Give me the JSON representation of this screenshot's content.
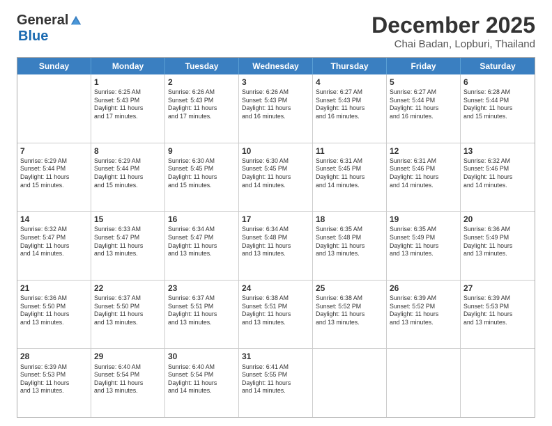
{
  "logo": {
    "general": "General",
    "blue": "Blue"
  },
  "title": "December 2025",
  "subtitle": "Chai Badan, Lopburi, Thailand",
  "header_days": [
    "Sunday",
    "Monday",
    "Tuesday",
    "Wednesday",
    "Thursday",
    "Friday",
    "Saturday"
  ],
  "weeks": [
    [
      {
        "day": "",
        "info": ""
      },
      {
        "day": "1",
        "info": "Sunrise: 6:25 AM\nSunset: 5:43 PM\nDaylight: 11 hours\nand 17 minutes."
      },
      {
        "day": "2",
        "info": "Sunrise: 6:26 AM\nSunset: 5:43 PM\nDaylight: 11 hours\nand 17 minutes."
      },
      {
        "day": "3",
        "info": "Sunrise: 6:26 AM\nSunset: 5:43 PM\nDaylight: 11 hours\nand 16 minutes."
      },
      {
        "day": "4",
        "info": "Sunrise: 6:27 AM\nSunset: 5:43 PM\nDaylight: 11 hours\nand 16 minutes."
      },
      {
        "day": "5",
        "info": "Sunrise: 6:27 AM\nSunset: 5:44 PM\nDaylight: 11 hours\nand 16 minutes."
      },
      {
        "day": "6",
        "info": "Sunrise: 6:28 AM\nSunset: 5:44 PM\nDaylight: 11 hours\nand 15 minutes."
      }
    ],
    [
      {
        "day": "7",
        "info": "Sunrise: 6:29 AM\nSunset: 5:44 PM\nDaylight: 11 hours\nand 15 minutes."
      },
      {
        "day": "8",
        "info": "Sunrise: 6:29 AM\nSunset: 5:44 PM\nDaylight: 11 hours\nand 15 minutes."
      },
      {
        "day": "9",
        "info": "Sunrise: 6:30 AM\nSunset: 5:45 PM\nDaylight: 11 hours\nand 15 minutes."
      },
      {
        "day": "10",
        "info": "Sunrise: 6:30 AM\nSunset: 5:45 PM\nDaylight: 11 hours\nand 14 minutes."
      },
      {
        "day": "11",
        "info": "Sunrise: 6:31 AM\nSunset: 5:45 PM\nDaylight: 11 hours\nand 14 minutes."
      },
      {
        "day": "12",
        "info": "Sunrise: 6:31 AM\nSunset: 5:46 PM\nDaylight: 11 hours\nand 14 minutes."
      },
      {
        "day": "13",
        "info": "Sunrise: 6:32 AM\nSunset: 5:46 PM\nDaylight: 11 hours\nand 14 minutes."
      }
    ],
    [
      {
        "day": "14",
        "info": "Sunrise: 6:32 AM\nSunset: 5:47 PM\nDaylight: 11 hours\nand 14 minutes."
      },
      {
        "day": "15",
        "info": "Sunrise: 6:33 AM\nSunset: 5:47 PM\nDaylight: 11 hours\nand 13 minutes."
      },
      {
        "day": "16",
        "info": "Sunrise: 6:34 AM\nSunset: 5:47 PM\nDaylight: 11 hours\nand 13 minutes."
      },
      {
        "day": "17",
        "info": "Sunrise: 6:34 AM\nSunset: 5:48 PM\nDaylight: 11 hours\nand 13 minutes."
      },
      {
        "day": "18",
        "info": "Sunrise: 6:35 AM\nSunset: 5:48 PM\nDaylight: 11 hours\nand 13 minutes."
      },
      {
        "day": "19",
        "info": "Sunrise: 6:35 AM\nSunset: 5:49 PM\nDaylight: 11 hours\nand 13 minutes."
      },
      {
        "day": "20",
        "info": "Sunrise: 6:36 AM\nSunset: 5:49 PM\nDaylight: 11 hours\nand 13 minutes."
      }
    ],
    [
      {
        "day": "21",
        "info": "Sunrise: 6:36 AM\nSunset: 5:50 PM\nDaylight: 11 hours\nand 13 minutes."
      },
      {
        "day": "22",
        "info": "Sunrise: 6:37 AM\nSunset: 5:50 PM\nDaylight: 11 hours\nand 13 minutes."
      },
      {
        "day": "23",
        "info": "Sunrise: 6:37 AM\nSunset: 5:51 PM\nDaylight: 11 hours\nand 13 minutes."
      },
      {
        "day": "24",
        "info": "Sunrise: 6:38 AM\nSunset: 5:51 PM\nDaylight: 11 hours\nand 13 minutes."
      },
      {
        "day": "25",
        "info": "Sunrise: 6:38 AM\nSunset: 5:52 PM\nDaylight: 11 hours\nand 13 minutes."
      },
      {
        "day": "26",
        "info": "Sunrise: 6:39 AM\nSunset: 5:52 PM\nDaylight: 11 hours\nand 13 minutes."
      },
      {
        "day": "27",
        "info": "Sunrise: 6:39 AM\nSunset: 5:53 PM\nDaylight: 11 hours\nand 13 minutes."
      }
    ],
    [
      {
        "day": "28",
        "info": "Sunrise: 6:39 AM\nSunset: 5:53 PM\nDaylight: 11 hours\nand 13 minutes."
      },
      {
        "day": "29",
        "info": "Sunrise: 6:40 AM\nSunset: 5:54 PM\nDaylight: 11 hours\nand 13 minutes."
      },
      {
        "day": "30",
        "info": "Sunrise: 6:40 AM\nSunset: 5:54 PM\nDaylight: 11 hours\nand 14 minutes."
      },
      {
        "day": "31",
        "info": "Sunrise: 6:41 AM\nSunset: 5:55 PM\nDaylight: 11 hours\nand 14 minutes."
      },
      {
        "day": "",
        "info": ""
      },
      {
        "day": "",
        "info": ""
      },
      {
        "day": "",
        "info": ""
      }
    ]
  ]
}
